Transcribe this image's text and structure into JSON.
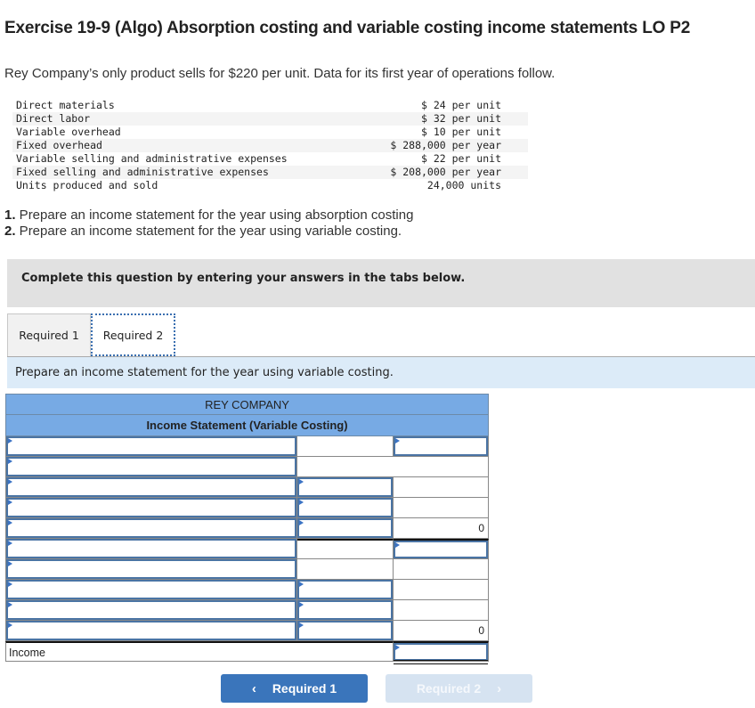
{
  "title": "Exercise 19-9 (Algo) Absorption costing and variable costing income statements LO P2",
  "intro": "Rey Company’s only product sells for $220 per unit. Data for its first year of operations follow.",
  "cost_data": [
    {
      "label": "Direct materials",
      "value": "$ 24 per unit"
    },
    {
      "label": "Direct labor",
      "value": "$ 32 per unit"
    },
    {
      "label": "Variable overhead",
      "value": "$ 10 per unit"
    },
    {
      "label": "Fixed overhead",
      "value": "$ 288,000 per year"
    },
    {
      "label": "Variable selling and administrative expenses",
      "value": "$ 22 per unit"
    },
    {
      "label": "Fixed selling and administrative expenses",
      "value": "$ 208,000 per year"
    },
    {
      "label": "Units produced and sold",
      "value": "24,000 units"
    }
  ],
  "requirements": [
    {
      "num": "1.",
      "text": " Prepare an income statement for the year using absorption costing"
    },
    {
      "num": "2.",
      "text": " Prepare an income statement for the year using variable costing."
    }
  ],
  "banner": "Complete this question by entering your answers in the tabs below.",
  "tabs": [
    {
      "label": "Required 1",
      "active": false
    },
    {
      "label": "Required 2",
      "active": true
    }
  ],
  "instruction": "Prepare an income statement for the year using variable costing.",
  "statement": {
    "company": "REY COMPANY",
    "subtitle": "Income Statement (Variable Costing)",
    "subtotal_1": "0",
    "subtotal_2": "0",
    "income_label": "Income"
  },
  "nav": {
    "prev_label": "Required 1",
    "next_label": "Required 2",
    "prev_icon": "‹",
    "next_icon": "›"
  }
}
